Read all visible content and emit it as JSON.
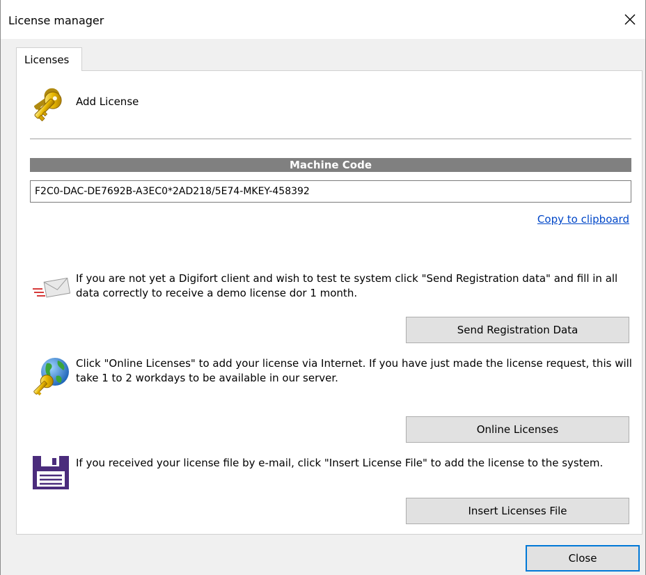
{
  "window": {
    "title": "License manager"
  },
  "tabs": [
    {
      "label": "Licenses"
    }
  ],
  "add_license": {
    "label": "Add License",
    "icon": "key-icon"
  },
  "machine_code": {
    "header": "Machine Code",
    "value": "F2C0-DAC-DE7692B-A3EC0*2AD218/5E74-MKEY-458392",
    "copy_link": "Copy to clipboard"
  },
  "sections": [
    {
      "icon": "mail-icon",
      "text": "If you are not yet a Digifort client and wish to test te system click \"Send Registration data\" and fill in all data correctly to receive a demo license dor 1 month.",
      "button": "Send Registration Data"
    },
    {
      "icon": "globe-key-icon",
      "text": "Click \"Online Licenses\" to add your license via Internet. If you have just made the license request, this will take 1 to 2 workdays to be available in our server.",
      "button": "Online Licenses"
    },
    {
      "icon": "floppy-icon",
      "text": "If you received your license file by e-mail, click \"Insert License File\" to add the license to the system.",
      "button": "Insert Licenses File"
    }
  ],
  "footer": {
    "close_label": "Close"
  },
  "colors": {
    "header_bg": "#808080",
    "link": "#0047c8",
    "focus_border": "#0078d7",
    "floppy": "#4b2c7c"
  }
}
